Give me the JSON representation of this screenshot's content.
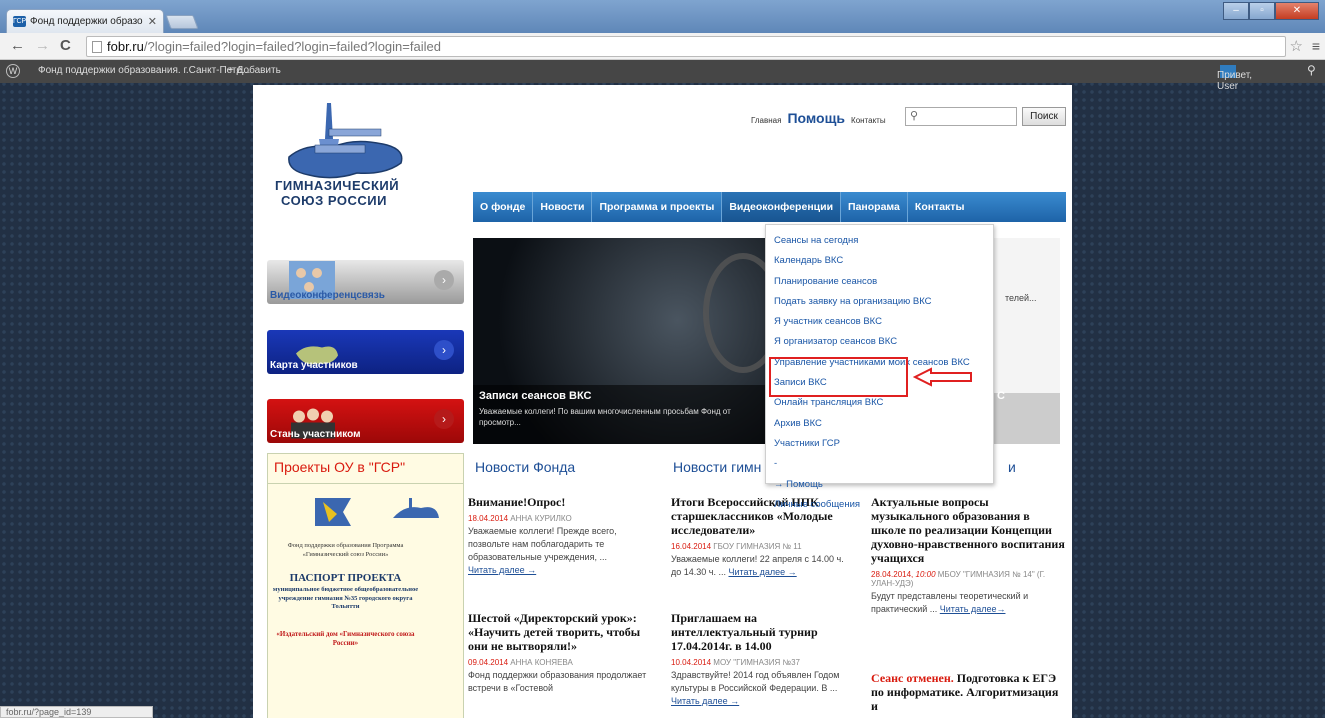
{
  "browser": {
    "tab_title": "Фонд поддержки образо",
    "tab_icon": "ГСР",
    "url_host": "fobr.ru",
    "url_rest": "/?login=failed?login=failed?login=failed?login=failed"
  },
  "wpbar": {
    "site": "Фонд поддержки образования. г.Санкт-Пете...",
    "add": "+ Добавить",
    "greeting": "Привет, User"
  },
  "logo": {
    "line1": "ГИМНАЗИЧЕСКИЙ",
    "line2": "СОЮЗ РОССИИ"
  },
  "toplinks": {
    "home": "Главная",
    "help": "Помощь",
    "contacts": "Контакты",
    "search_button": "Поиск"
  },
  "nav": [
    "О фонде",
    "Новости",
    "Программа и проекты",
    "Видеоконференции",
    "Панорама",
    "Контакты"
  ],
  "banners": [
    {
      "label": "Видеоконференцсвязь",
      "arrow": "›"
    },
    {
      "label": "Карта участников",
      "arrow": "›"
    },
    {
      "label": "Стань участником",
      "arrow": "›"
    }
  ],
  "slider": {
    "title": "Записи сеансов ВКС",
    "text": "Уважаемые коллеги! По вашим многочисленным просьбам Фонд от просмотр...",
    "right_text": "телей...",
    "right_mark": "С"
  },
  "dropdown": [
    "Сеансы на сегодня",
    "Календарь ВКС",
    "Планирование сеансов",
    "Подать заявку на организацию ВКС",
    "Я участник сеансов ВКС",
    "Я организатор сеансов ВКС",
    "Управление участниками моих сеансов ВКС",
    "Записи ВКС",
    "Онлайн трансляция ВКС",
    "Архив ВКС",
    "Участники ГСР",
    "-",
    "→ Помощь",
    "Личные сообщения"
  ],
  "projects": {
    "title": "Проекты ОУ в \"ГСР\"",
    "fund": "Фонд поддержки образования Программа «Гимназический союз России»",
    "passport": "ПАСПОРТ ПРОЕКТА",
    "school": "муниципальное бюджетное общеобразовательное учреждение гимназия №35 городского округа Тольятти",
    "publisher": "«Издательский дом «Гимназического союза России»"
  },
  "columns": {
    "c1": "Новости Фонда",
    "c2": "Новости гимн",
    "c3": "и"
  },
  "news": {
    "n1": {
      "title": "Внимание!Опрос!",
      "date": "18.04.2014",
      "author": "АННА КУРИЛКО",
      "body": "Уважаемые коллеги! Прежде всего, позвольте нам поблагодарить те образовательные учреждения, ...",
      "more": "Читать далее →"
    },
    "n2": {
      "title": "Шестой «Директорский урок»: «Научить детей творить, чтобы они не вытворяли!»",
      "date": "09.04.2014",
      "author": "АННА КОНЯЕВА",
      "body": "Фонд поддержки образования продолжает встречи в «Гостевой"
    },
    "n3": {
      "title": "Итоги Всероссийской НПК старшеклассников «Молодые исследователи»",
      "date": "16.04.2014",
      "author": "ГБОУ ГИМНАЗИЯ № 11",
      "body": "Уважаемые коллеги! 22 апреля с 14.00 ч. до 14.30 ч. ...",
      "more": "Читать далее →"
    },
    "n4": {
      "title": "Приглашаем на интеллектуальный турнир 17.04.2014г. в 14.00",
      "date": "10.04.2014",
      "author": "МОУ \"ГИМНАЗИЯ №37",
      "body": "Здравствуйте! 2014 год объявлен Годом культуры в Российской Федерации. В ...",
      "more": "Читать далее →"
    },
    "n5": {
      "title": "Актуальные вопросы музыкального образования в школе по реализации Концепции духовно-нравственного воспитания учащихся",
      "date": "28.04.2014,",
      "time": "10:00",
      "author": "МБОУ \"ГИМНАЗИЯ № 14\" (Г. УЛАН-УДЭ)",
      "body": "Будут представлены теоретический и практический ...",
      "more": "Читать далее→"
    },
    "n6": {
      "red": "Сеанс отменен.",
      "title": "Подготовка к ЕГЭ по информатике. Алгоритмизация и"
    }
  },
  "status": "fobr.ru/?page_id=139"
}
